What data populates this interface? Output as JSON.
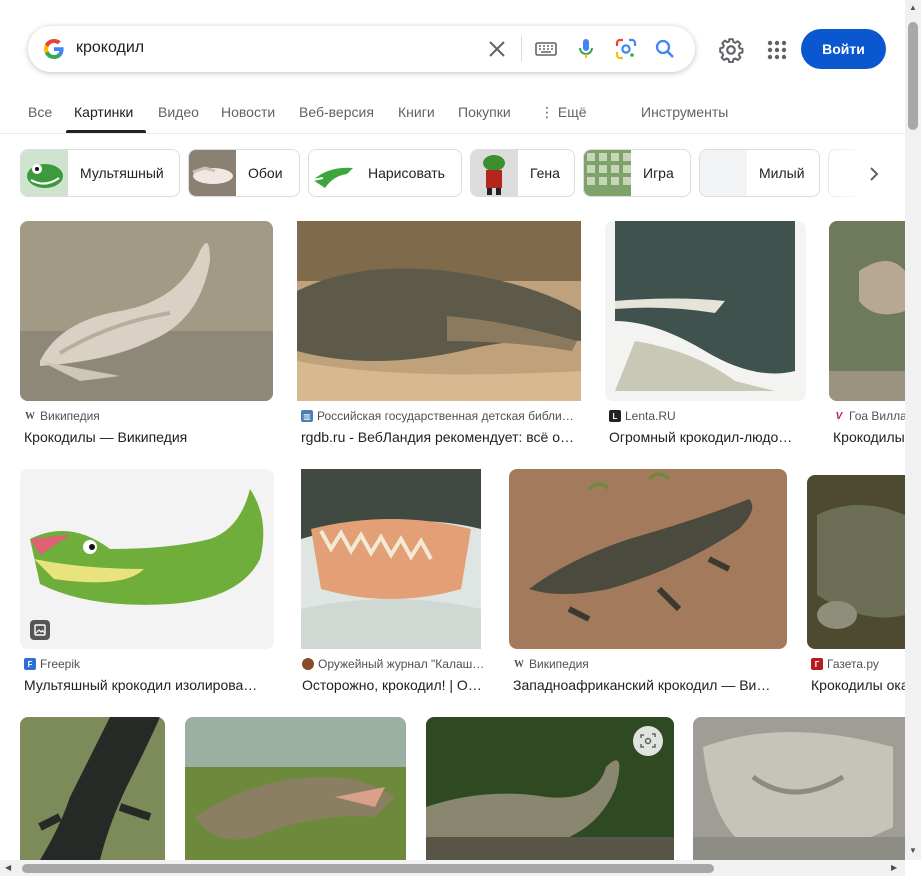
{
  "search": {
    "query": "крокодил"
  },
  "header": {
    "login_label": "Войти"
  },
  "tabs": [
    {
      "label": "Все"
    },
    {
      "label": "Картинки"
    },
    {
      "label": "Видео"
    },
    {
      "label": "Новости"
    },
    {
      "label": "Веб-версия"
    },
    {
      "label": "Книги"
    },
    {
      "label": "Покупки"
    },
    {
      "label": "⋮ Ещё"
    },
    {
      "label": "Инструменты"
    }
  ],
  "chips": [
    {
      "label": "Мультяшный"
    },
    {
      "label": "Обои"
    },
    {
      "label": "Нарисовать"
    },
    {
      "label": "Гена"
    },
    {
      "label": "Игра"
    },
    {
      "label": "Милый"
    }
  ],
  "results": [
    {
      "source": "Википедия",
      "title": "Крокодилы — Википедия"
    },
    {
      "source": "Российская государственная детская библи…",
      "title": "rgdb.ru - ВебЛандия рекомендует: всё о…"
    },
    {
      "source": "Lenta.RU",
      "title": "Огромный крокодил-людо…"
    },
    {
      "source": "Гоа Вилла",
      "title": "Крокодилы"
    },
    {
      "source": "Freepik",
      "title": "Мультяшный крокодил изолирова…"
    },
    {
      "source": "Оружейный журнал \"Калаш…",
      "title": "Осторожно, крокодил! | О…"
    },
    {
      "source": "Википедия",
      "title": "Западноафриканский крокодил — Ви…"
    },
    {
      "source": "Газета.ру",
      "title": "Крокодилы ока"
    }
  ],
  "colors": {
    "accent": "#0b57d0",
    "text": "#202124",
    "muted": "#5f6368"
  }
}
